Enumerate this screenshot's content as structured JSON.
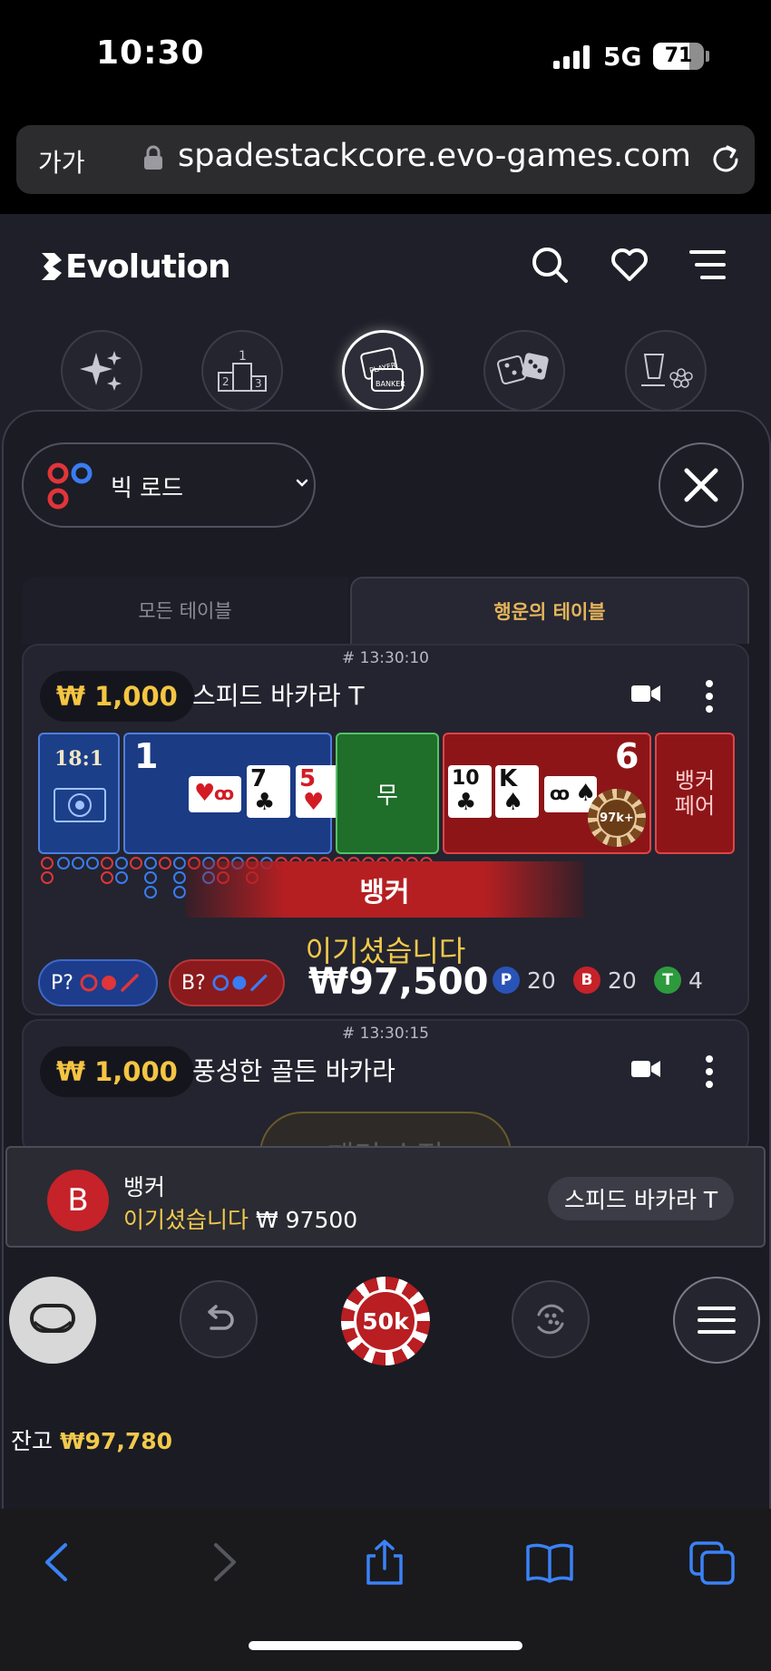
{
  "status_bar": {
    "time": "10:30",
    "network": "5G",
    "battery": "71"
  },
  "browser": {
    "text_size_label": "가가",
    "url": "spadestackcore.evo-games.com"
  },
  "app": {
    "brand": "Evolution"
  },
  "road_selector": {
    "label": "빅 로드"
  },
  "tabs": {
    "all_tables": "모든 테이블",
    "lucky_tables": "행운의 테이블"
  },
  "table1": {
    "game_id": "# 13:30:10",
    "stake": "₩ 1,000",
    "name": "스피드 바카라 T",
    "odds": "18:1",
    "player_score": "1",
    "banker_score": "6",
    "tie_label": "무",
    "banker_pair_label": "뱅커\n페어",
    "player_cards": [
      {
        "rank": "",
        "suit": "♥"
      },
      {
        "rank": "7",
        "suit": "♣"
      },
      {
        "rank": "5",
        "suit": "♥"
      }
    ],
    "banker_cards": [
      {
        "rank": "10",
        "suit": "♣"
      },
      {
        "rank": "K",
        "suit": "♠"
      },
      {
        "rank": "",
        "suit": "♠"
      }
    ],
    "pot_chip": "97k+",
    "result_banner": "뱅커",
    "won_label": "이기셨습니다",
    "won_amount": "₩97,500",
    "predict_player": "P?",
    "predict_banker": "B?",
    "stats": {
      "player": "20",
      "banker": "20",
      "tie": "4"
    },
    "stat_badges": {
      "player": "P",
      "banker": "B",
      "tie": "T"
    }
  },
  "table2": {
    "game_id": "# 13:30:15",
    "stake": "₩ 1,000",
    "name": "풍성한 골든 바카라"
  },
  "pattern_button": "패턴 수정",
  "toast": {
    "badge": "B",
    "title": "뱅커",
    "won_label": "이기셨습니다",
    "amount": "₩ 97500",
    "table": "스피드 바카라 T"
  },
  "chip_value": "50k",
  "balance": {
    "label": "잔고",
    "value": "₩97,780"
  },
  "colors": {
    "player": "#1b3b85",
    "banker": "#8d1518",
    "tie": "#1f6e2a",
    "gold": "#f2c94c"
  }
}
